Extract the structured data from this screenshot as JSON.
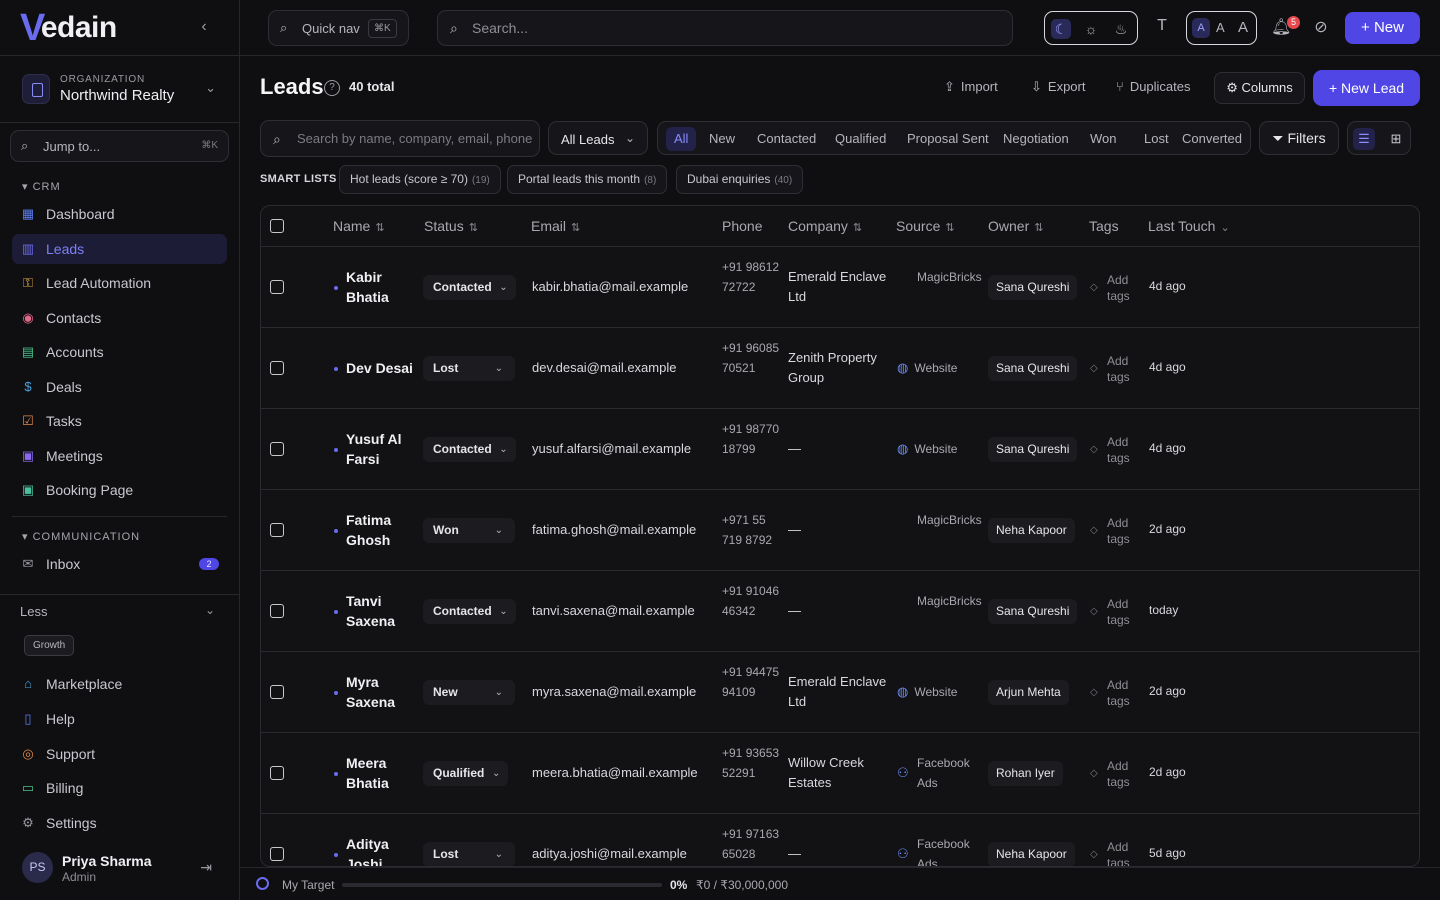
{
  "brand": {
    "logo_mark": "V",
    "logo_text": "edain"
  },
  "sidebar": {
    "org_label": "ORGANIZATION",
    "org_name": "Northwind Realty",
    "jump_placeholder": "Jump to...",
    "jump_shortcut": "⌘K",
    "section_crm": "CRM",
    "crm_items": [
      {
        "label": "Dashboard",
        "icon": "grid-icon",
        "color": "#5b7cf0"
      },
      {
        "label": "Leads",
        "icon": "leads-icon",
        "color": "#6a6cf0",
        "active": true
      },
      {
        "label": "Lead Automation",
        "icon": "automation-icon",
        "color": "#e0a84a"
      },
      {
        "label": "Contacts",
        "icon": "contacts-icon",
        "color": "#e06a8a"
      },
      {
        "label": "Accounts",
        "icon": "building-icon",
        "color": "#4ac08a"
      },
      {
        "label": "Deals",
        "icon": "dollar-icon",
        "color": "#4aa0e0"
      },
      {
        "label": "Tasks",
        "icon": "task-icon",
        "color": "#e0884a"
      },
      {
        "label": "Meetings",
        "icon": "calendar-icon",
        "color": "#8a6af0"
      },
      {
        "label": "Booking Page",
        "icon": "booking-icon",
        "color": "#4ac0a0"
      }
    ],
    "section_comm": "COMMUNICATION",
    "comm_items": [
      {
        "label": "Inbox",
        "icon": "mail-icon",
        "color": "#9a9aa2",
        "badge": "2"
      }
    ],
    "less_label": "Less",
    "growth_label": "Growth",
    "bottom_items": [
      {
        "label": "Marketplace",
        "icon": "store-icon",
        "color": "#4aa0e0"
      },
      {
        "label": "Help",
        "icon": "book-icon",
        "color": "#5b7cf0"
      },
      {
        "label": "Support",
        "icon": "lifebuoy-icon",
        "color": "#e0884a"
      },
      {
        "label": "Billing",
        "icon": "card-icon",
        "color": "#4ac08a"
      },
      {
        "label": "Settings",
        "icon": "gear-icon",
        "color": "#9a9aa2"
      }
    ],
    "user": {
      "initials": "PS",
      "name": "Priya Sharma",
      "role": "Admin"
    }
  },
  "topbar": {
    "quick_nav": "Quick nav",
    "quick_nav_shortcut": "⌘K",
    "search_placeholder": "Search...",
    "font_sizes": [
      "A",
      "A",
      "A"
    ],
    "notification_count": "5",
    "new_label": "New"
  },
  "page": {
    "title": "Leads",
    "total": "40 total",
    "actions": {
      "import": "Import",
      "export": "Export",
      "duplicates": "Duplicates",
      "columns": "Columns",
      "new_lead": "New Lead"
    }
  },
  "filters": {
    "search_placeholder": "Search by name, company, email, phone...",
    "view_select": "All Leads",
    "status_tabs": [
      "All",
      "New",
      "Contacted",
      "Qualified",
      "Proposal Sent",
      "Negotiation",
      "Won",
      "Lost",
      "Converted"
    ],
    "active_tab": "All",
    "filters_label": "Filters"
  },
  "smart_lists": {
    "label": "SMART LISTS",
    "items": [
      {
        "label": "Hot leads (score ≥ 70)",
        "count": "(19)"
      },
      {
        "label": "Portal leads this month",
        "count": "(8)"
      },
      {
        "label": "Dubai enquiries",
        "count": "(40)"
      }
    ]
  },
  "table": {
    "columns": [
      "Name",
      "Status",
      "Email",
      "Phone",
      "Company",
      "Source",
      "Owner",
      "Tags",
      "Last Touch"
    ],
    "add_tags": "Add tags",
    "rows": [
      {
        "name": "Kabir Bhatia",
        "status": "Contacted",
        "email": "kabir.bhatia@mail.example",
        "phone": "+91 98612 72722",
        "company": "Emerald Enclave Ltd",
        "source": "MagicBricks",
        "owner": "Sana Qureshi",
        "last_touch": "4d ago"
      },
      {
        "name": "Dev Desai",
        "status": "Lost",
        "email": "dev.desai@mail.example",
        "phone": "+91 96085 70521",
        "company": "Zenith Property Group",
        "source": "Website",
        "owner": "Sana Qureshi",
        "last_touch": "4d ago"
      },
      {
        "name": "Yusuf Al Farsi",
        "status": "Contacted",
        "email": "yusuf.alfarsi@mail.example",
        "phone": "+91 98770 18799",
        "company": "—",
        "source": "Website",
        "owner": "Sana Qureshi",
        "last_touch": "4d ago"
      },
      {
        "name": "Fatima Ghosh",
        "status": "Won",
        "email": "fatima.ghosh@mail.example",
        "phone": "+971 55 719 8792",
        "company": "—",
        "source": "MagicBricks",
        "owner": "Neha Kapoor",
        "last_touch": "2d ago"
      },
      {
        "name": "Tanvi Saxena",
        "status": "Contacted",
        "email": "tanvi.saxena@mail.example",
        "phone": "+91 91046 46342",
        "company": "—",
        "source": "MagicBricks",
        "owner": "Sana Qureshi",
        "last_touch": "today"
      },
      {
        "name": "Myra Saxena",
        "status": "New",
        "email": "myra.saxena@mail.example",
        "phone": "+91 94475 94109",
        "company": "Emerald Enclave Ltd",
        "source": "Website",
        "owner": "Arjun Mehta",
        "last_touch": "2d ago"
      },
      {
        "name": "Meera Bhatia",
        "status": "Qualified",
        "email": "meera.bhatia@mail.example",
        "phone": "+91 93653 52291",
        "company": "Willow Creek Estates",
        "source": "Facebook Ads",
        "owner": "Rohan Iyer",
        "last_touch": "2d ago"
      },
      {
        "name": "Aditya Joshi",
        "status": "Lost",
        "email": "aditya.joshi@mail.example",
        "phone": "+91 97163 65028",
        "company": "—",
        "source": "Facebook Ads",
        "owner": "Neha Kapoor",
        "last_touch": "5d ago"
      }
    ]
  },
  "footer": {
    "target_label": "My Target",
    "progress": 0,
    "percent": "0%",
    "amount": "₹0 / ₹30,000,000"
  },
  "colors": {
    "accent": "#4f46e5",
    "accent_text": "#7d80f8",
    "background": "#0f0f12",
    "notification": "#e5484d"
  }
}
